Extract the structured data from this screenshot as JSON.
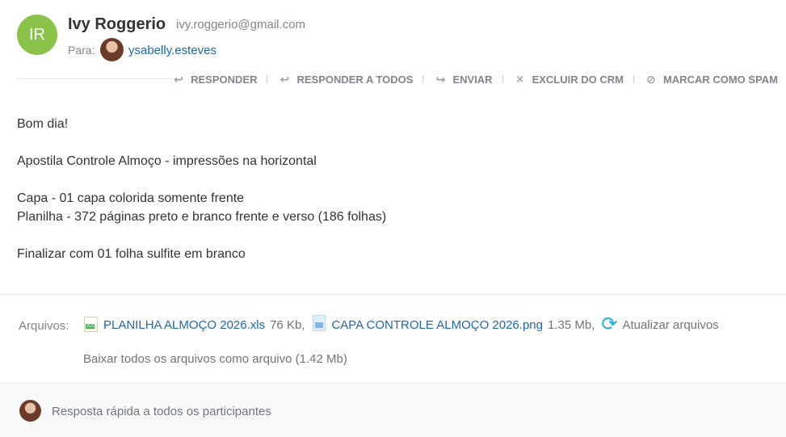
{
  "sender": {
    "initials": "IR",
    "name": "Ivy Roggerio",
    "email": "ivy.roggerio@gmail.com",
    "avatar_color": "#8bc34a"
  },
  "recipients": {
    "label": "Para:",
    "items": [
      {
        "name": "ysabelly.esteves"
      }
    ]
  },
  "actions": [
    {
      "label": "RESPONDER",
      "icon": "reply-icon"
    },
    {
      "label": "RESPONDER A TODOS",
      "icon": "reply-all-icon"
    },
    {
      "label": "ENVIAR",
      "icon": "forward-icon"
    },
    {
      "label": "EXCLUIR DO CRM",
      "icon": "close-icon"
    },
    {
      "label": "MARCAR COMO SPAM",
      "icon": "block-icon"
    }
  ],
  "body": {
    "greeting": "Bom dia!",
    "line1": "Apostila Controle Almoço - impressões na horizontal",
    "line2": "Capa - 01 capa colorida somente frente",
    "line3": "Planilha - 372 páginas preto e branco frente e verso (186 folhas)",
    "line4": "Finalizar com 01 folha sulfite em branco"
  },
  "attachments": {
    "label": "Arquivos:",
    "files": [
      {
        "name": "PLANILHA ALMOÇO 2026.xls",
        "size": "76 Kb,",
        "icon": "xls-file-icon"
      },
      {
        "name": "CAPA CONTROLE ALMOÇO 2026.png",
        "size": "1.35 Mb,",
        "icon": "image-file-icon"
      }
    ],
    "refresh_label": "Atualizar arquivos",
    "download_all": "Baixar todos os arquivos como arquivo (1.42 Mb)"
  },
  "quick_reply": {
    "placeholder": "Resposta rápida a todos os participantes"
  },
  "colors": {
    "link": "#2067b0",
    "accent_refresh": "#2aa9e0"
  }
}
